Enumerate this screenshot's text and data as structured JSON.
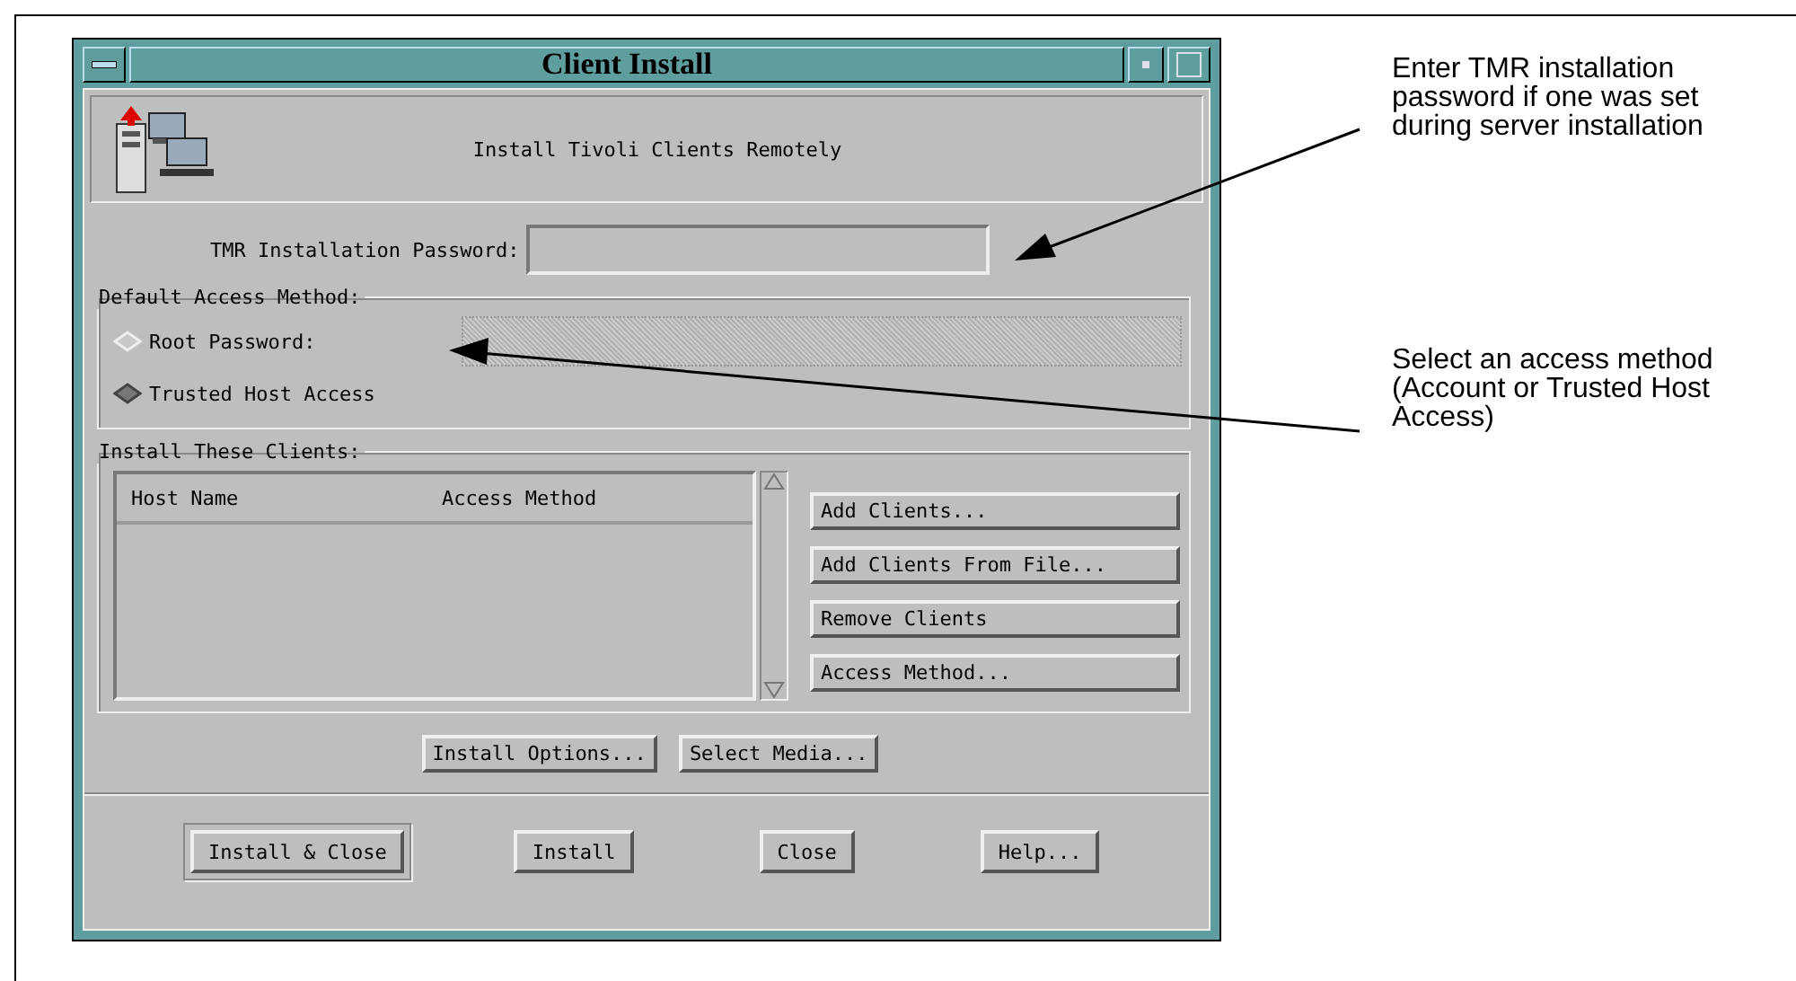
{
  "window": {
    "title": "Client Install",
    "header": "Install Tivoli Clients Remotely"
  },
  "password": {
    "label": "TMR Installation Password:"
  },
  "access_method": {
    "legend": "Default Access Method:",
    "options": [
      {
        "label": "Root Password:",
        "selected": false
      },
      {
        "label": "Trusted Host Access",
        "selected": true
      }
    ],
    "root_password_field": {
      "disabled": true
    }
  },
  "clients": {
    "legend": "Install These Clients:",
    "columns": [
      "Host Name",
      "Access Method"
    ],
    "buttons": [
      "Add Clients...",
      "Add Clients From File...",
      "Remove Clients",
      "Access Method..."
    ]
  },
  "option_buttons": [
    "Install Options...",
    "Select Media..."
  ],
  "dialog_buttons": [
    {
      "label": "Install & Close",
      "default": true
    },
    {
      "label": "Install",
      "default": false
    },
    {
      "label": "Close",
      "default": false
    },
    {
      "label": "Help...",
      "default": false
    }
  ],
  "callouts": [
    "Enter TMR installation password if one was set during server installation",
    "Select an access method (Account or Trusted Host Access)"
  ]
}
